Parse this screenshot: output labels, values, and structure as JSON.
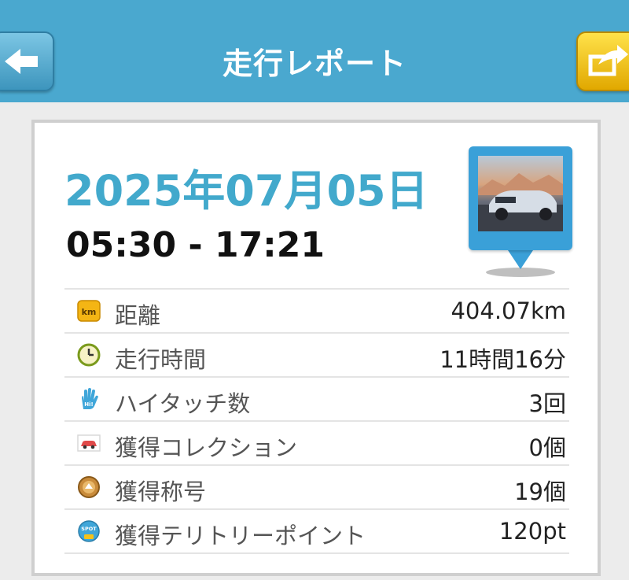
{
  "header": {
    "title": "走行レポート",
    "back_icon": "arrow-left-icon",
    "share_icon": "share-export-icon"
  },
  "report": {
    "date": "2025年07月05日",
    "time_range": "05:30 - 17:21",
    "thumbnail": "car-photo-pin"
  },
  "stats": [
    {
      "icon": "km-badge-icon",
      "label": "距離",
      "value": "404.07km"
    },
    {
      "icon": "clock-icon",
      "label": "走行時間",
      "value": "11時間16分"
    },
    {
      "icon": "high-five-hand-icon",
      "label": "ハイタッチ数",
      "value": "3回"
    },
    {
      "icon": "collection-car-icon",
      "label": "獲得コレクション",
      "value": "0個"
    },
    {
      "icon": "title-medal-icon",
      "label": "獲得称号",
      "value": "19個"
    },
    {
      "icon": "spot-badge-icon",
      "label": "獲得テリトリーポイント",
      "value": "120pt"
    }
  ],
  "colors": {
    "header_bg": "#4aa8cf",
    "date_text": "#42a9cc",
    "share_button": "#f2c200",
    "back_button": "#5fb4da"
  }
}
